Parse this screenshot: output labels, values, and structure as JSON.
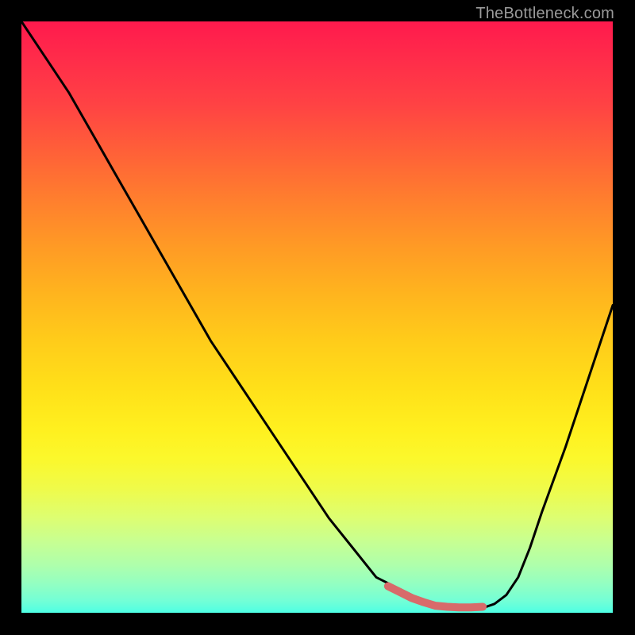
{
  "watermark": "TheBottleneck.com",
  "colors": {
    "gradient_top": "#ff1a4d",
    "gradient_mid": "#fff01f",
    "gradient_bottom": "#4effe4",
    "curve": "#000000",
    "bottom_segment": "#d86a6a",
    "frame": "#000000"
  },
  "chart_data": {
    "type": "line",
    "title": "",
    "xlabel": "",
    "ylabel": "",
    "xlim": [
      0,
      100
    ],
    "ylim": [
      0,
      100
    ],
    "grid": false,
    "legend": false,
    "series": [
      {
        "name": "black-curve",
        "x": [
          0,
          4,
          8,
          12,
          16,
          20,
          24,
          28,
          32,
          36,
          40,
          44,
          48,
          52,
          56,
          60,
          62,
          64,
          66,
          68,
          70,
          72,
          74,
          76,
          78,
          80,
          82,
          84,
          86,
          88,
          92,
          96,
          100
        ],
        "values": [
          100,
          94,
          88,
          81,
          74,
          67,
          60,
          53,
          46,
          40,
          34,
          28,
          22,
          16,
          11,
          6,
          5,
          4,
          3,
          2,
          1.5,
          1,
          0.8,
          0.7,
          0.8,
          1.5,
          3,
          6,
          11,
          17,
          28,
          40,
          52
        ]
      }
    ],
    "highlight_segment": {
      "name": "flat-bottom-highlight",
      "x_start": 62,
      "x_end": 78,
      "values": [
        4.5,
        3.5,
        2.5,
        1.8,
        1.2,
        1.0,
        0.9,
        0.9,
        1.0
      ],
      "color": "#d86a6a"
    }
  }
}
